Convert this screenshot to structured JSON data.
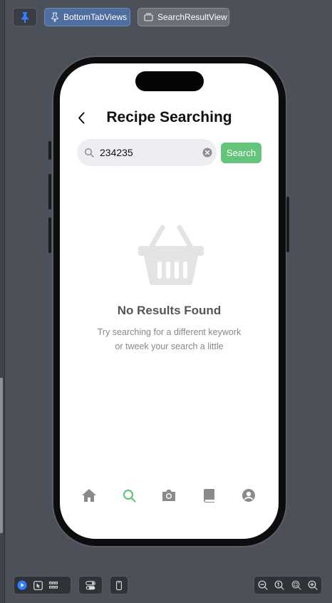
{
  "toolbar": {
    "pin_icon": "pin-icon",
    "chips": [
      {
        "label": "BottomTabViews",
        "icon": "pin-outline-icon"
      },
      {
        "label": "SearchResultView",
        "icon": "layers-icon"
      }
    ]
  },
  "screen": {
    "title": "Recipe Searching",
    "search": {
      "value": "234235",
      "button_label": "Search"
    },
    "empty_state": {
      "icon": "basket-icon",
      "title": "No Results Found",
      "message_line1": "Try searching for a different keywork",
      "message_line2": "or tweek your search a little"
    },
    "tabbar": [
      {
        "name": "home",
        "icon": "house-icon",
        "active": false
      },
      {
        "name": "search",
        "icon": "search-icon",
        "active": true
      },
      {
        "name": "camera",
        "icon": "camera-icon",
        "active": false
      },
      {
        "name": "book",
        "icon": "book-icon",
        "active": false
      },
      {
        "name": "profile",
        "icon": "person-circle-icon",
        "active": false
      }
    ]
  },
  "colors": {
    "background": "#4b5059",
    "accent_green": "#64c47a",
    "tab_inactive": "#8a8a8a",
    "chip_active": "#4f6d9f"
  }
}
